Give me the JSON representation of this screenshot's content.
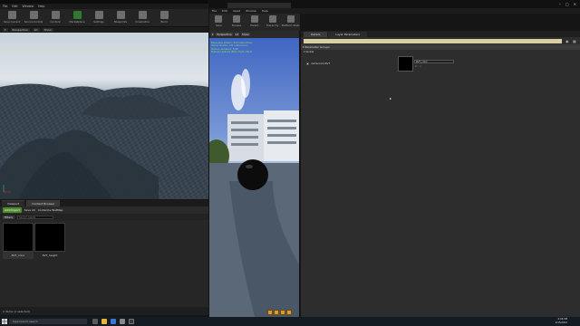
{
  "left_window": {
    "menu": [
      "File",
      "Edit",
      "Window",
      "Help"
    ],
    "toolbar": [
      "Save Current",
      "Source Control",
      "Content",
      "Marketplace",
      "Settings",
      "Blueprints",
      "Cinematics",
      "Build"
    ],
    "viewport": {
      "perspective_label": "Perspective",
      "lit_label": "Lit",
      "show_label": "Show"
    },
    "bottom_tabs": [
      "Viewport",
      "Content Browser"
    ],
    "content_browser": {
      "add_import": "Add/Import",
      "save_all": "Save All",
      "breadcrumb": "Content  ▸  TestMap",
      "filters": "Filters",
      "search_placeholder": "Search Assets",
      "assets": [
        {
          "label": "RVT_color"
        },
        {
          "label": "RVT_height"
        }
      ],
      "status": "2 items (1 selected)"
    }
  },
  "right_window": {
    "menu": [
      "File",
      "Edit",
      "Asset",
      "Window",
      "Help"
    ],
    "toolbar": [
      "Save",
      "Browse",
      "Parent",
      "Hierarchy",
      "Platform Stats",
      "Interactive"
    ],
    "preview": {
      "view_label": "Perspective",
      "lit_label": "Lit",
      "show_label": "Show",
      "stats": [
        "Base pass shader: 210 instructions",
        "Vertex shader: 131 instructions",
        "Texture samplers: 5/16",
        "Texture Lookups (Est): VS(0), PS(1)"
      ]
    },
    "details": {
      "tabs": [
        "Details",
        "Layer Parameters"
      ],
      "search_placeholder": "Search Details",
      "group_header": "Parameter Groups",
      "global_label": "Global",
      "param_name": "vertexcolorRVT",
      "param_value": "RVT_color"
    },
    "window_controls": [
      "–",
      "□",
      "✕"
    ]
  },
  "taskbar": {
    "search_placeholder": "Type here to search",
    "time": "4:06 PM",
    "date": "2/15/2022"
  },
  "colors": {
    "accent_green": "#4e8c2e",
    "search_highlight": "#d7d0a3",
    "stats_green": "#8ddc6a"
  }
}
